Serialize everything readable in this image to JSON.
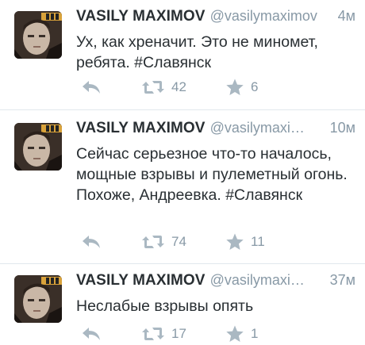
{
  "tweets": [
    {
      "name": "VASILY MAXIMOV",
      "handle": "@vasilymaximov",
      "time": "4м",
      "text": "Ух, как хреначит. Это не миномет, ребята. #Славянск",
      "retweets": "42",
      "favorites": "6"
    },
    {
      "name": "VASILY MAXIMOV",
      "handle": "@vasilymaxi…",
      "time": "10м",
      "text": "Сейчас серьезное что-то началось, мощные взрывы и пулеметный огонь. Похоже, Андреевка. #Славянск",
      "retweets": "74",
      "favorites": "11"
    },
    {
      "name": "VASILY MAXIMOV",
      "handle": "@vasilymaxi…",
      "time": "37м",
      "text": "Неслабые взрывы опять",
      "retweets": "17",
      "favorites": "1"
    }
  ],
  "icons": {
    "reply": "reply-icon",
    "retweet": "retweet-icon",
    "favorite": "star-icon"
  },
  "colors": {
    "text": "#292f33",
    "meta": "#8899a6",
    "icon": "#aab8c2",
    "divider": "#e1e8ed"
  }
}
